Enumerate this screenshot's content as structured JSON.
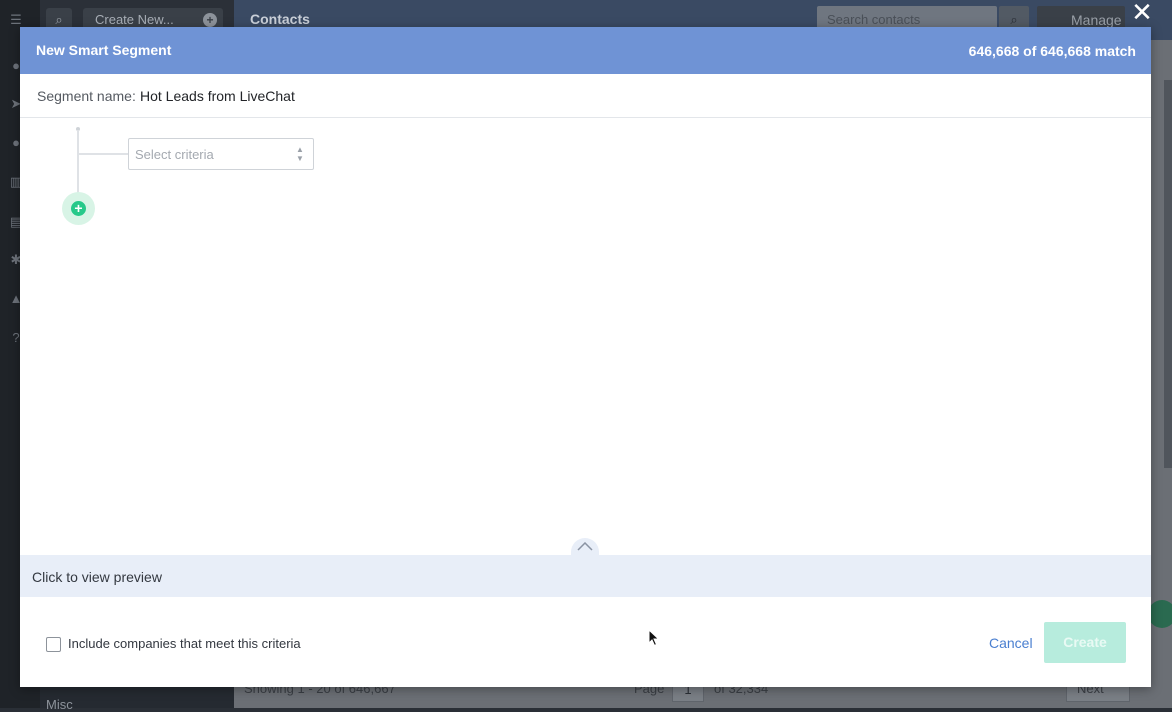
{
  "background_app": {
    "create_new_label": "Create New...",
    "section_title": "Contacts",
    "search_placeholder": "Search contacts",
    "manage_label": "Manage",
    "showing_text": "Showing 1 - 20 of 646,667",
    "page_label": "Page",
    "page_value": "1",
    "of_pages": "of 32,334",
    "next_label": "Next",
    "misc_label": "Misc"
  },
  "modal": {
    "close_icon": "close-icon",
    "title": "New Smart Segment",
    "match_count": "646,668 of 646,668 match",
    "segment_name_label": "Segment name:",
    "segment_name_value": "Hot Leads from LiveChat",
    "criteria_placeholder": "Select criteria",
    "preview_label": "Click to view preview",
    "include_companies_label": "Include companies that meet this criteria",
    "include_companies_checked": false,
    "cancel_label": "Cancel",
    "create_label": "Create"
  },
  "colors": {
    "header_blue": "#6f93d5",
    "add_green": "#27c98a",
    "create_disabled": "#b7ecdd",
    "link_blue": "#4a7fd0"
  }
}
